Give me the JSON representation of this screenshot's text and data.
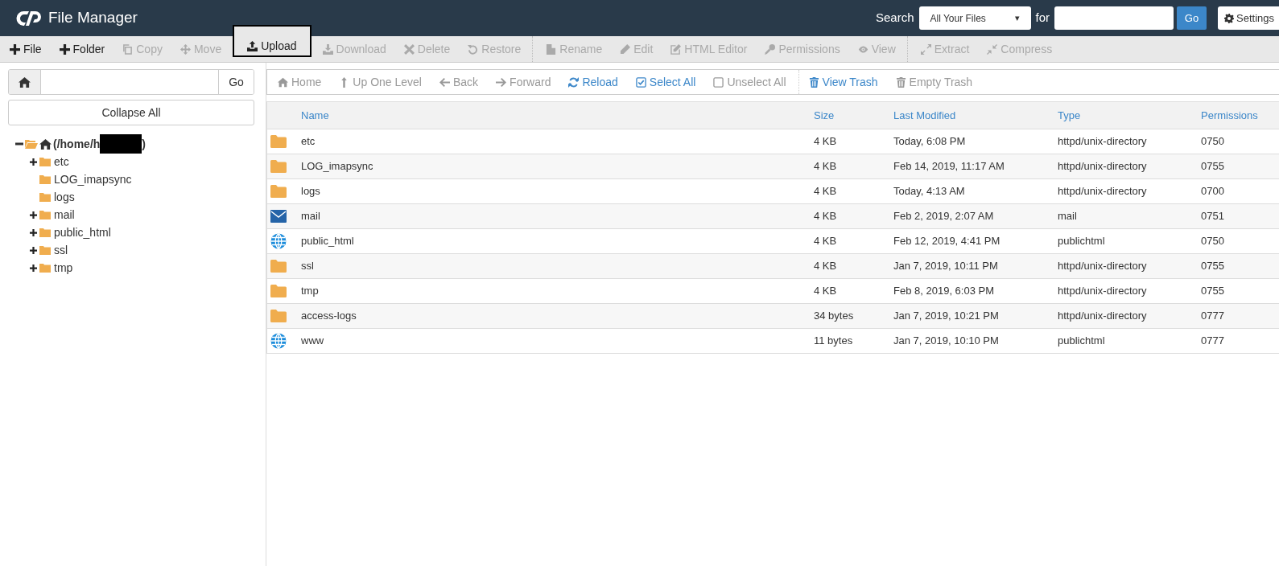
{
  "window": {
    "title": "File Manager"
  },
  "search": {
    "label": "Search",
    "scope": "All Your Files",
    "scope_caret": "▾",
    "for_label": "for",
    "go": "Go",
    "settings": "Settings"
  },
  "toolbar": [
    {
      "label": "File",
      "disabled": false,
      "highlighted": false,
      "separator_before": false
    },
    {
      "label": "Folder",
      "disabled": false,
      "highlighted": false,
      "separator_before": false
    },
    {
      "label": "Copy",
      "disabled": true,
      "highlighted": false,
      "separator_before": false
    },
    {
      "label": "Move",
      "disabled": true,
      "highlighted": false,
      "separator_before": false
    },
    {
      "label": "Upload",
      "disabled": false,
      "highlighted": true,
      "separator_before": false
    },
    {
      "label": "Download",
      "disabled": true,
      "highlighted": false,
      "separator_before": false
    },
    {
      "label": "Delete",
      "disabled": true,
      "highlighted": false,
      "separator_before": false
    },
    {
      "label": "Restore",
      "disabled": true,
      "highlighted": false,
      "separator_before": false
    },
    {
      "label": "Rename",
      "disabled": true,
      "highlighted": false,
      "separator_before": true
    },
    {
      "label": "Edit",
      "disabled": true,
      "highlighted": false,
      "separator_before": false
    },
    {
      "label": "HTML Editor",
      "disabled": true,
      "highlighted": false,
      "separator_before": false
    },
    {
      "label": "Permissions",
      "disabled": true,
      "highlighted": false,
      "separator_before": false
    },
    {
      "label": "View",
      "disabled": true,
      "highlighted": false,
      "separator_before": false
    },
    {
      "label": "Extract",
      "disabled": true,
      "highlighted": false,
      "separator_before": true
    },
    {
      "label": "Compress",
      "disabled": true,
      "highlighted": false,
      "separator_before": false
    }
  ],
  "path_bar": {
    "go": "Go"
  },
  "collapse_all": "Collapse All",
  "tree": {
    "label": "(/home/h",
    "label_end": ")",
    "redacted": true,
    "expanded": true,
    "children": [
      {
        "label": "etc",
        "has_children": true
      },
      {
        "label": "LOG_imapsync",
        "has_children": false
      },
      {
        "label": "logs",
        "has_children": false
      },
      {
        "label": "mail",
        "has_children": true
      },
      {
        "label": "public_html",
        "has_children": true
      },
      {
        "label": "ssl",
        "has_children": true
      },
      {
        "label": "tmp",
        "has_children": true
      }
    ]
  },
  "nav": [
    {
      "label": "Home",
      "disabled": true,
      "separator_before": false
    },
    {
      "label": "Up One Level",
      "disabled": true,
      "separator_before": false
    },
    {
      "label": "Back",
      "disabled": true,
      "separator_before": false
    },
    {
      "label": "Forward",
      "disabled": true,
      "separator_before": false
    },
    {
      "label": "Reload",
      "disabled": false,
      "separator_before": false
    },
    {
      "label": "Select All",
      "disabled": false,
      "separator_before": false
    },
    {
      "label": "Unselect All",
      "disabled": true,
      "separator_before": false
    },
    {
      "label": "View Trash",
      "disabled": false,
      "separator_before": true
    },
    {
      "label": "Empty Trash",
      "disabled": true,
      "separator_before": false
    }
  ],
  "table": {
    "columns": [
      "Name",
      "Size",
      "Last Modified",
      "Type",
      "Permissions"
    ],
    "rows": [
      {
        "kind": "folder",
        "name": "etc",
        "size": "4 KB",
        "modified": "Today, 6:08 PM",
        "type": "httpd/unix-directory",
        "permissions": "0750"
      },
      {
        "kind": "folder",
        "name": "LOG_imapsync",
        "size": "4 KB",
        "modified": "Feb 14, 2019, 11:17 AM",
        "type": "httpd/unix-directory",
        "permissions": "0755"
      },
      {
        "kind": "folder",
        "name": "logs",
        "size": "4 KB",
        "modified": "Today, 4:13 AM",
        "type": "httpd/unix-directory",
        "permissions": "0700"
      },
      {
        "kind": "mail",
        "name": "mail",
        "size": "4 KB",
        "modified": "Feb 2, 2019, 2:07 AM",
        "type": "mail",
        "permissions": "0751"
      },
      {
        "kind": "web",
        "name": "public_html",
        "size": "4 KB",
        "modified": "Feb 12, 2019, 4:41 PM",
        "type": "publichtml",
        "permissions": "0750"
      },
      {
        "kind": "folder",
        "name": "ssl",
        "size": "4 KB",
        "modified": "Jan 7, 2019, 10:11 PM",
        "type": "httpd/unix-directory",
        "permissions": "0755"
      },
      {
        "kind": "folder",
        "name": "tmp",
        "size": "4 KB",
        "modified": "Feb 8, 2019, 6:03 PM",
        "type": "httpd/unix-directory",
        "permissions": "0755"
      },
      {
        "kind": "folder",
        "name": "access-logs",
        "size": "34 bytes",
        "modified": "Jan 7, 2019, 10:21 PM",
        "type": "httpd/unix-directory",
        "permissions": "0777"
      },
      {
        "kind": "web",
        "name": "www",
        "size": "11 bytes",
        "modified": "Jan 7, 2019, 10:10 PM",
        "type": "publichtml",
        "permissions": "0777"
      }
    ]
  }
}
